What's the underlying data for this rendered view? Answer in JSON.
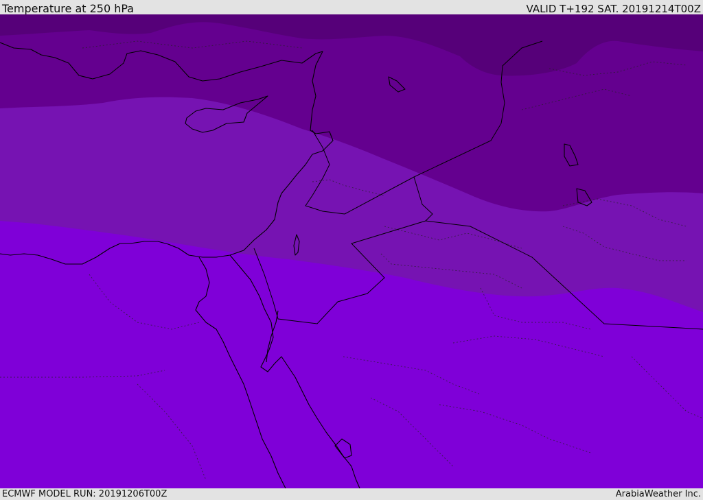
{
  "header": {
    "title": "Temperature at 250 hPa",
    "valid": "VALID T+192 SAT. 20191214T00Z"
  },
  "footer": {
    "model_run": "ECMWF MODEL RUN: 20191206T00Z",
    "credit": "ArabiaWeather Inc."
  },
  "map": {
    "colors": {
      "band_coldest": "#560079",
      "band_cold": "#64008f",
      "band_mid": "#7613b2",
      "band_warm": "#7f00d8",
      "coastline": "#000000"
    }
  }
}
